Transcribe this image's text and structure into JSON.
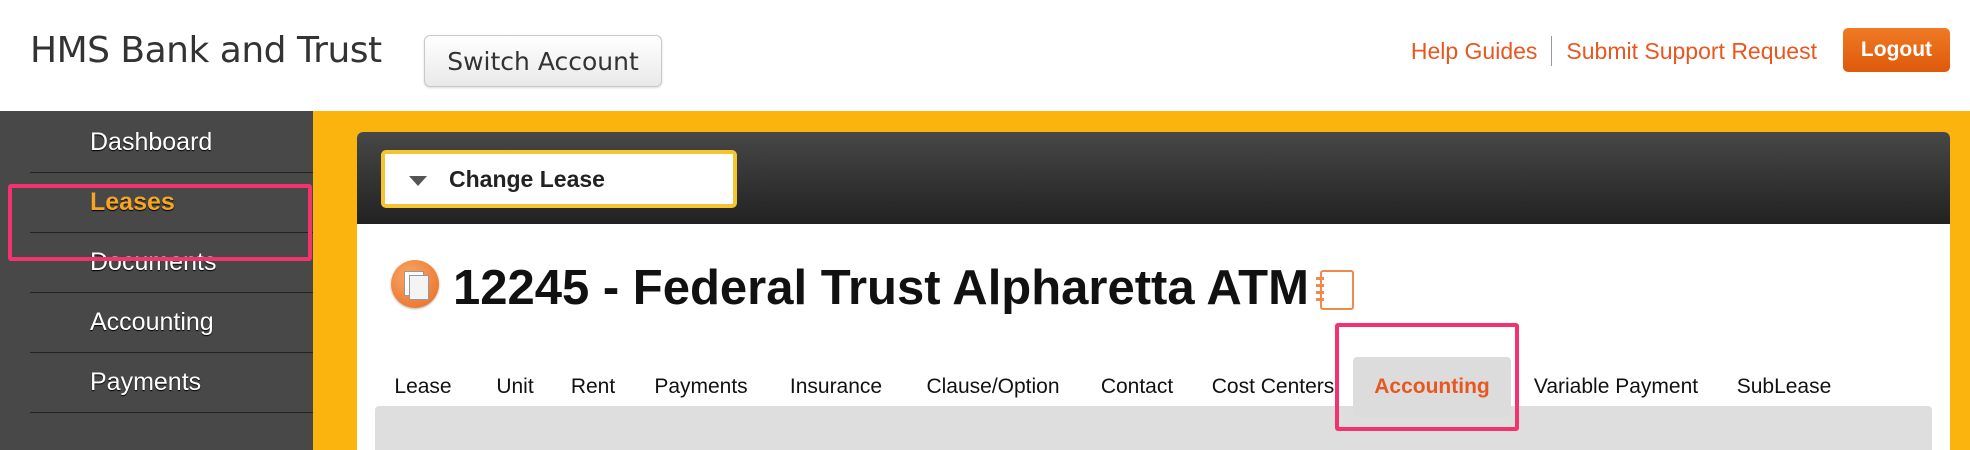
{
  "header": {
    "brand": "HMS Bank and Trust",
    "switch_account": "Switch Account",
    "help_guides": "Help Guides",
    "submit_support": "Submit Support Request",
    "logout": "Logout"
  },
  "sidebar": {
    "items": [
      {
        "label": "Dashboard"
      },
      {
        "label": "Leases"
      },
      {
        "label": "Documents"
      },
      {
        "label": "Accounting"
      },
      {
        "label": "Payments"
      }
    ]
  },
  "main": {
    "change_lease": "Change Lease",
    "title": "12245 - Federal Trust Alpharetta ATM",
    "tabs": [
      {
        "label": "Lease"
      },
      {
        "label": "Unit"
      },
      {
        "label": "Rent"
      },
      {
        "label": "Payments"
      },
      {
        "label": "Insurance"
      },
      {
        "label": "Clause/Option"
      },
      {
        "label": "Contact"
      },
      {
        "label": "Cost Centers"
      },
      {
        "label": "Accounting"
      },
      {
        "label": "Variable Payment"
      },
      {
        "label": "SubLease"
      }
    ],
    "active_tab": "Accounting"
  },
  "colors": {
    "accent_orange": "#e8571f",
    "frame_yellow": "#fbb40d",
    "highlight_pink": "#f2336f",
    "sidebar_bg": "#484848"
  }
}
